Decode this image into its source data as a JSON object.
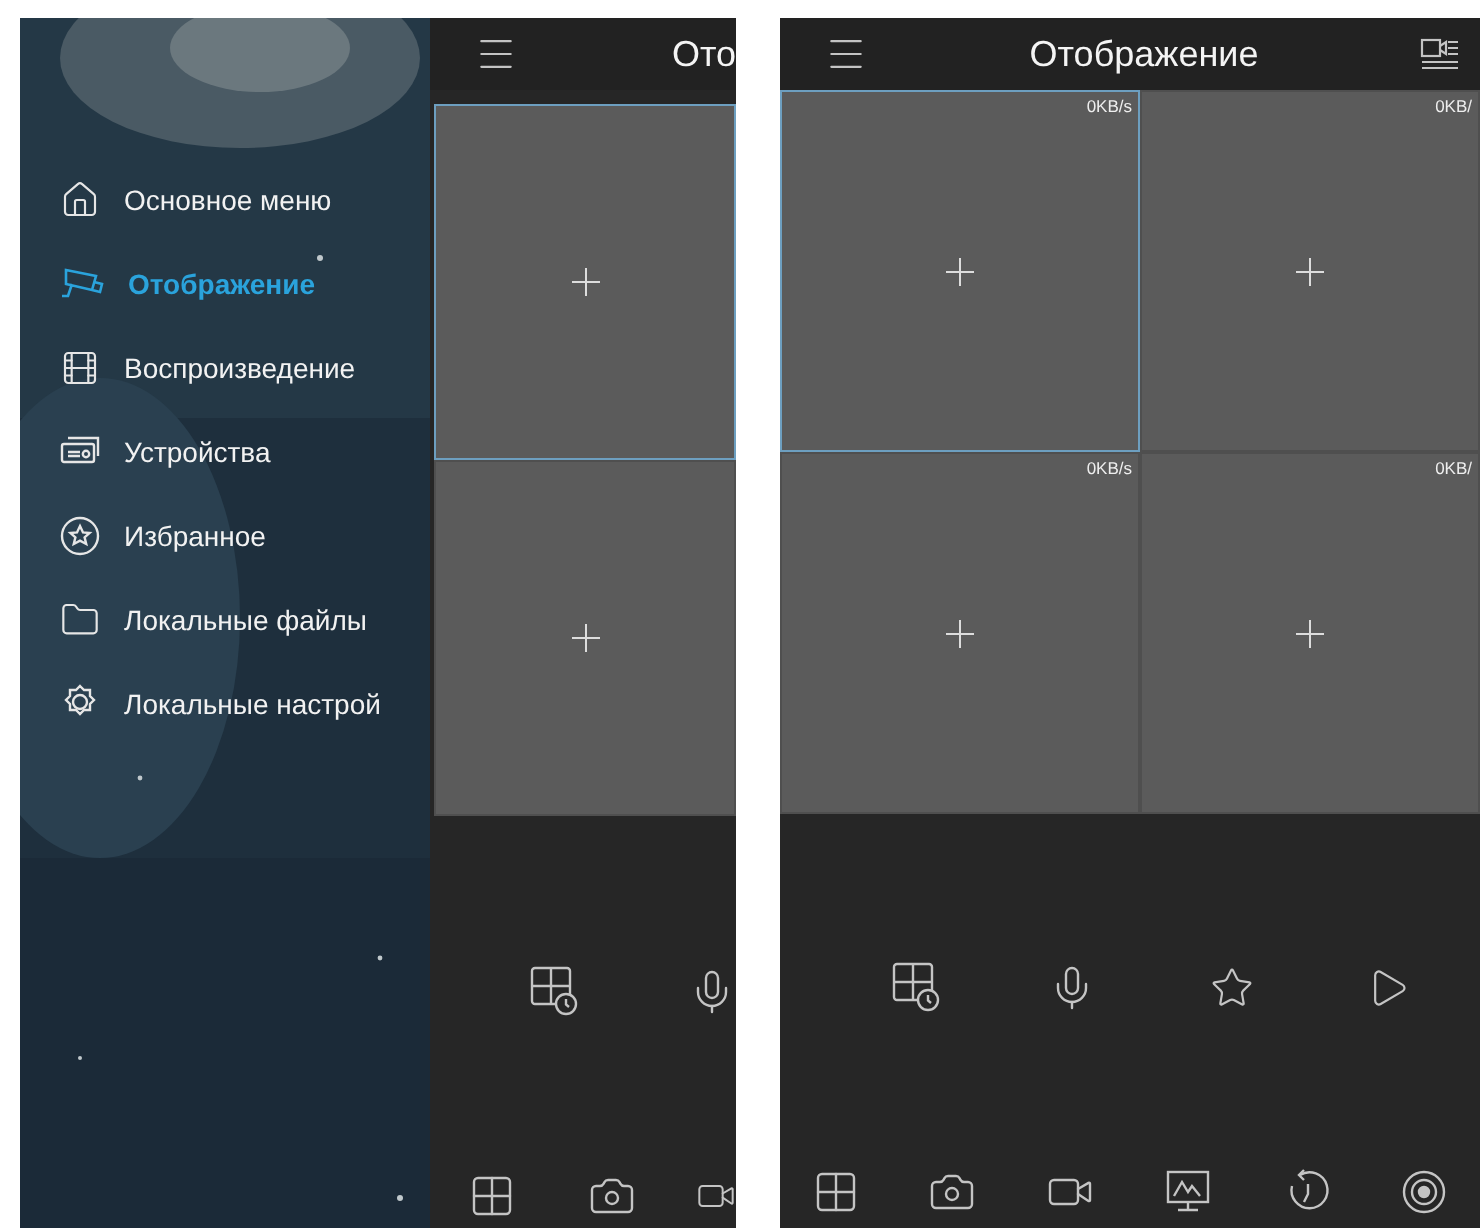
{
  "left_screen": {
    "sidebar": {
      "items": [
        {
          "label": "Основное меню",
          "selected": false
        },
        {
          "label": "Отображение",
          "selected": true
        },
        {
          "label": "Воспроизведение",
          "selected": false
        },
        {
          "label": "Устройства",
          "selected": false
        },
        {
          "label": "Избранное",
          "selected": false
        },
        {
          "label": "Локальные файлы",
          "selected": false
        },
        {
          "label": "Локальные настрой",
          "selected": false
        }
      ]
    },
    "header": {
      "title": "Ото"
    },
    "tiles": [
      {
        "selected": true
      },
      {
        "selected": false
      }
    ]
  },
  "right_screen": {
    "header": {
      "title": "Отображение"
    },
    "tiles": [
      {
        "rate": "0KB/s",
        "selected": true
      },
      {
        "rate": "0KB/",
        "selected": false
      },
      {
        "rate": "0KB/s",
        "selected": false
      },
      {
        "rate": "0KB/",
        "selected": false
      }
    ]
  }
}
